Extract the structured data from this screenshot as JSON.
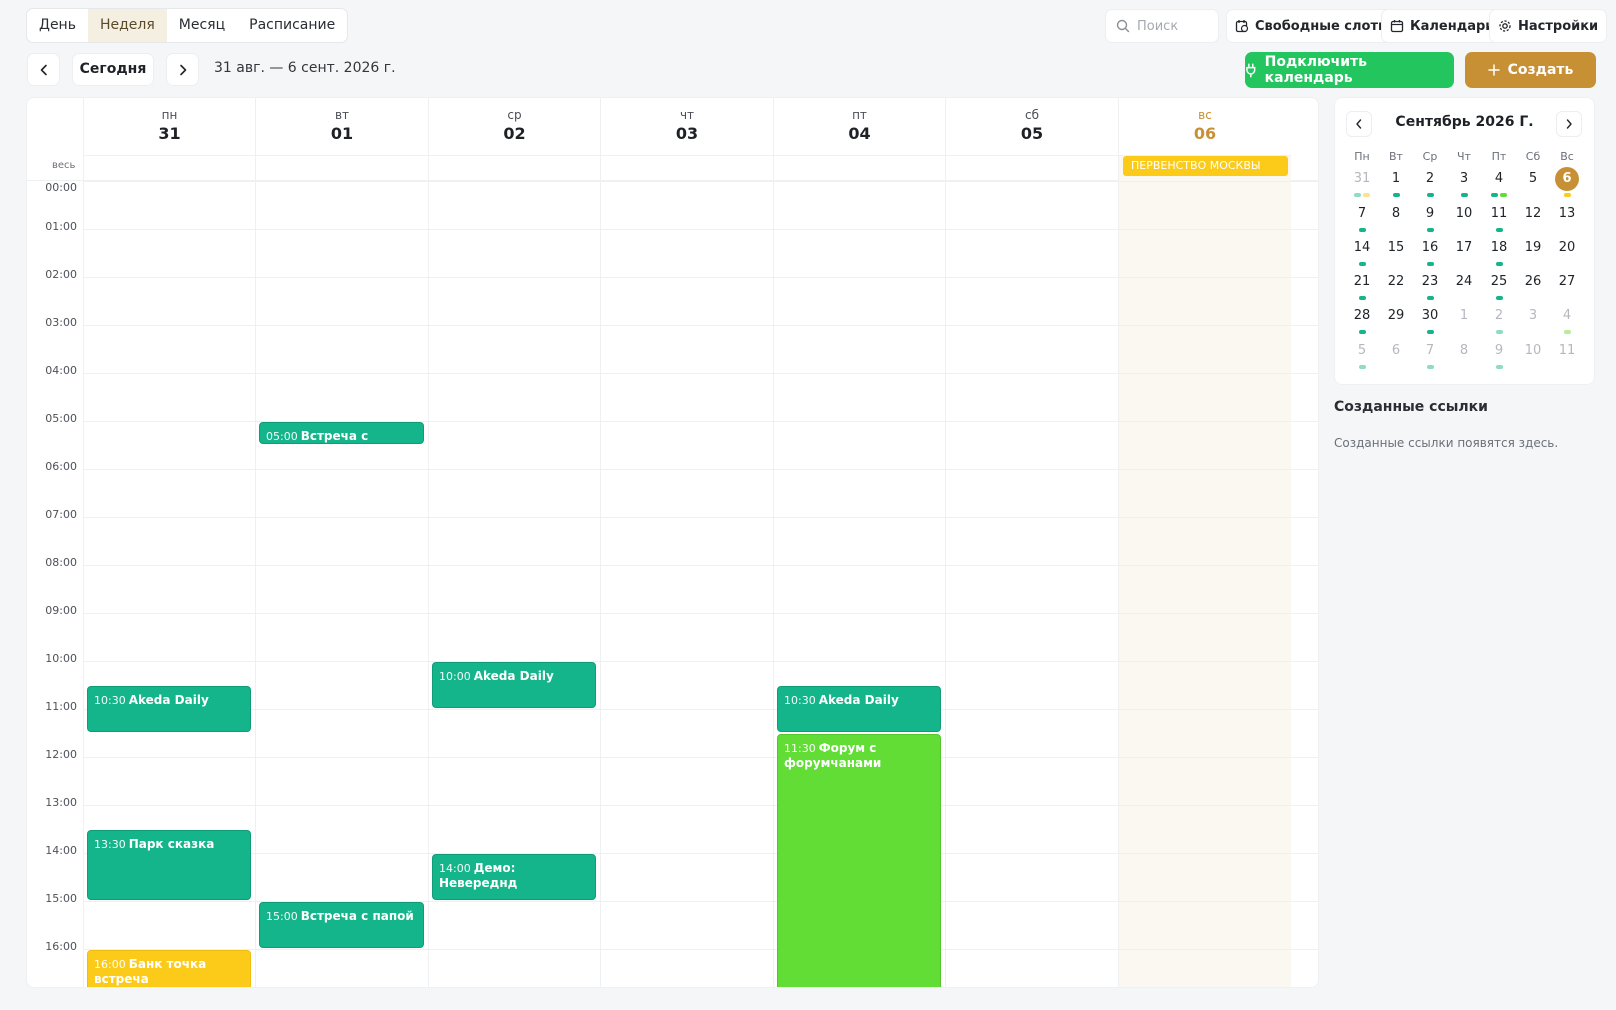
{
  "view_tabs": [
    {
      "label": "День"
    },
    {
      "label": "Неделя",
      "active": true
    },
    {
      "label": "Месяц"
    },
    {
      "label": "Расписание"
    }
  ],
  "search": {
    "placeholder": "Поиск"
  },
  "toolbar": {
    "free_slots": "Свободные слоты",
    "calendars": "Календари",
    "settings": "Настройки",
    "today": "Сегодня",
    "range": "31 авг. — 6 сент. 2026 г.",
    "connect": "Подключить календарь",
    "create": "Создать"
  },
  "colors": {
    "accent": "#c89034",
    "connect": "#22c55e",
    "event_teal": "#14b58a",
    "event_green": "#61dd35",
    "event_yellow": "#fccb1a"
  },
  "week": {
    "days": [
      {
        "dow": "пн",
        "num": "31"
      },
      {
        "dow": "вт",
        "num": "01"
      },
      {
        "dow": "ср",
        "num": "02"
      },
      {
        "dow": "чт",
        "num": "03"
      },
      {
        "dow": "пт",
        "num": "04"
      },
      {
        "dow": "сб",
        "num": "05"
      },
      {
        "dow": "вс",
        "num": "06",
        "today": true
      }
    ],
    "allday_label": "весь",
    "hours": [
      "00:00",
      "01:00",
      "02:00",
      "03:00",
      "04:00",
      "05:00",
      "06:00",
      "07:00",
      "08:00",
      "09:00",
      "10:00",
      "11:00",
      "12:00",
      "13:00",
      "14:00",
      "15:00",
      "16:00"
    ],
    "allday_events": [
      {
        "day": 6,
        "title": "ПЕРВЕНСТВО МОСКВЫ",
        "color": "yellow"
      }
    ],
    "events": [
      {
        "day": 1,
        "start": "05:00",
        "end": "05:30",
        "time": "05:00",
        "title": "Встреча с Артуром",
        "color": "teal"
      },
      {
        "day": 0,
        "start": "10:30",
        "end": "11:30",
        "time": "10:30",
        "title": "Akeda Daily",
        "color": "teal"
      },
      {
        "day": 2,
        "start": "10:00",
        "end": "11:00",
        "time": "10:00",
        "title": "Akeda Daily",
        "color": "teal"
      },
      {
        "day": 4,
        "start": "10:30",
        "end": "11:30",
        "time": "10:30",
        "title": "Akeda Daily",
        "color": "teal"
      },
      {
        "day": 4,
        "start": "11:30",
        "end": "17:00",
        "time": "11:30",
        "title": "Форум с форумчанами",
        "color": "green"
      },
      {
        "day": 0,
        "start": "13:30",
        "end": "15:00",
        "time": "13:30",
        "title": "Парк сказка",
        "color": "teal"
      },
      {
        "day": 2,
        "start": "14:00",
        "end": "15:00",
        "time": "14:00",
        "title": "Демо: Невереднд",
        "color": "teal"
      },
      {
        "day": 1,
        "start": "15:00",
        "end": "16:00",
        "time": "15:00",
        "title": "Встреча с папой",
        "color": "teal"
      },
      {
        "day": 0,
        "start": "16:00",
        "end": "17:00",
        "time": "16:00",
        "title": "Банк точка встреча",
        "color": "yellow"
      }
    ]
  },
  "mini_calendar": {
    "title": "Сентябрь 2026 Г.",
    "dow": [
      "Пн",
      "Вт",
      "Ср",
      "Чт",
      "Пт",
      "Сб",
      "Вс"
    ],
    "weeks": [
      [
        {
          "d": "31",
          "other": true,
          "dots": [
            "teal-light",
            "yellow-light"
          ]
        },
        {
          "d": "1",
          "dots": [
            "teal"
          ]
        },
        {
          "d": "2",
          "dots": [
            "teal"
          ]
        },
        {
          "d": "3",
          "dots": [
            "teal"
          ]
        },
        {
          "d": "4",
          "dots": [
            "teal",
            "green"
          ]
        },
        {
          "d": "5",
          "dots": []
        },
        {
          "d": "6",
          "today": true,
          "dots": [
            "yellow"
          ]
        }
      ],
      [
        {
          "d": "7",
          "dots": [
            "teal"
          ]
        },
        {
          "d": "8",
          "dots": []
        },
        {
          "d": "9",
          "dots": [
            "teal"
          ]
        },
        {
          "d": "10",
          "dots": []
        },
        {
          "d": "11",
          "dots": [
            "teal"
          ]
        },
        {
          "d": "12",
          "dots": []
        },
        {
          "d": "13",
          "dots": []
        }
      ],
      [
        {
          "d": "14",
          "dots": [
            "teal"
          ]
        },
        {
          "d": "15",
          "dots": []
        },
        {
          "d": "16",
          "dots": [
            "teal"
          ]
        },
        {
          "d": "17",
          "dots": []
        },
        {
          "d": "18",
          "dots": [
            "teal"
          ]
        },
        {
          "d": "19",
          "dots": []
        },
        {
          "d": "20",
          "dots": []
        }
      ],
      [
        {
          "d": "21",
          "dots": [
            "teal"
          ]
        },
        {
          "d": "22",
          "dots": []
        },
        {
          "d": "23",
          "dots": [
            "teal"
          ]
        },
        {
          "d": "24",
          "dots": []
        },
        {
          "d": "25",
          "dots": [
            "teal"
          ]
        },
        {
          "d": "26",
          "dots": []
        },
        {
          "d": "27",
          "dots": []
        }
      ],
      [
        {
          "d": "28",
          "dots": [
            "teal"
          ]
        },
        {
          "d": "29",
          "dots": []
        },
        {
          "d": "30",
          "dots": [
            "teal"
          ]
        },
        {
          "d": "1",
          "other": true,
          "dots": []
        },
        {
          "d": "2",
          "other": true,
          "dots": [
            "teal-light"
          ]
        },
        {
          "d": "3",
          "other": true,
          "dots": []
        },
        {
          "d": "4",
          "other": true,
          "dots": [
            "green-light"
          ]
        }
      ],
      [
        {
          "d": "5",
          "other": true,
          "dots": [
            "teal-light"
          ]
        },
        {
          "d": "6",
          "other": true,
          "dots": []
        },
        {
          "d": "7",
          "other": true,
          "dots": [
            "teal-light"
          ]
        },
        {
          "d": "8",
          "other": true,
          "dots": []
        },
        {
          "d": "9",
          "other": true,
          "dots": [
            "teal-light"
          ]
        },
        {
          "d": "10",
          "other": true,
          "dots": []
        },
        {
          "d": "11",
          "other": true,
          "dots": []
        }
      ]
    ]
  },
  "links": {
    "title": "Созданные ссылки",
    "empty": "Созданные ссылки появятся здесь."
  }
}
